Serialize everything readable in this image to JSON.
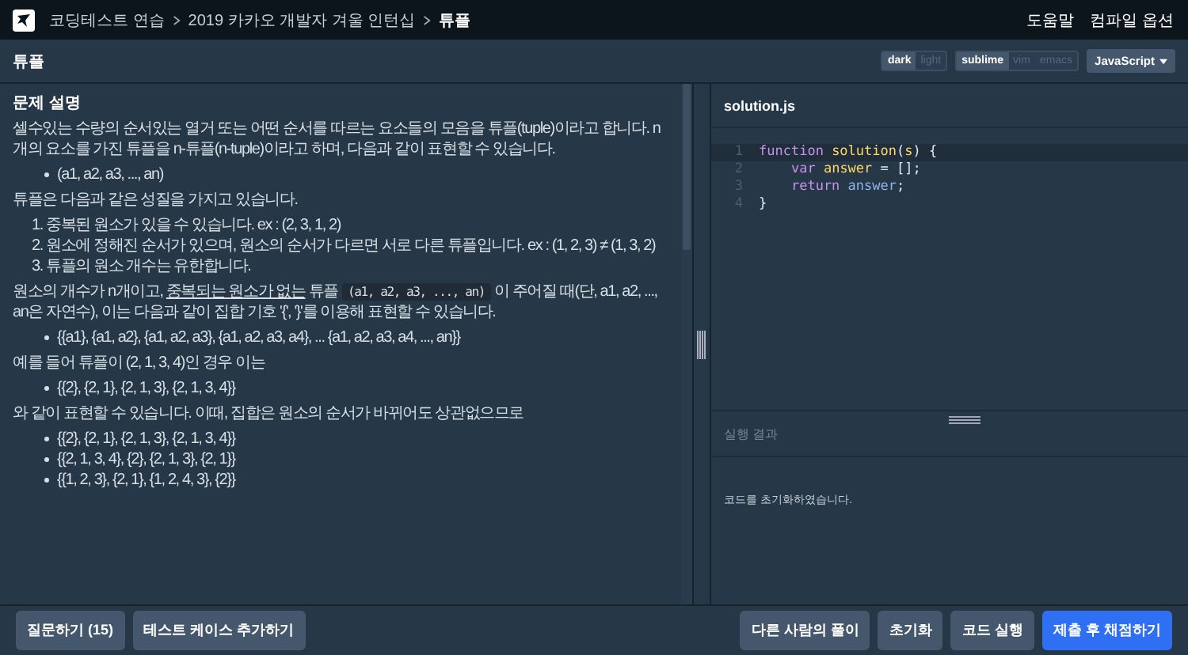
{
  "nav": {
    "breadcrumbs": [
      "코딩테스트 연습",
      "2019 카카오 개발자 겨울 인턴십",
      "튜플"
    ],
    "links": [
      "도움말",
      "컴파일 옵션"
    ]
  },
  "title_bar": {
    "title": "튜플",
    "toggle_groups": [
      [
        {
          "label": "dark",
          "selected": true
        },
        {
          "label": "light",
          "selected": false
        }
      ],
      [
        {
          "label": "sublime",
          "selected": true
        },
        {
          "label": "vim",
          "selected": false
        },
        {
          "label": "emacs",
          "selected": false
        }
      ]
    ],
    "language": "JavaScript"
  },
  "description": [
    {
      "kind": "heading",
      "text": "문제 설명"
    },
    {
      "kind": "paragraph",
      "parts": [
        {
          "kind": "text",
          "text": "셀수있는 수량의 순서있는 열거 또는 어떤 순서를 따르는 요소들의 모음을 튜플(tuple)이라고 합니다. n개의 요소를 가진 튜플을 n-튜플(n-tuple)이라고 하며, 다음과 같이 표현할 수 있습니다."
        }
      ]
    },
    {
      "kind": "bullets",
      "items": [
        "(a1, a2, a3, ..., an)"
      ]
    },
    {
      "kind": "paragraph",
      "parts": [
        {
          "kind": "text",
          "text": "튜플은 다음과 같은 성질을 가지고 있습니다."
        }
      ]
    },
    {
      "kind": "numbered",
      "items": [
        "1. 중복된 원소가 있을 수 있습니다. ex : (2, 3, 1, 2)",
        "2. 원소에 정해진 순서가 있으며, 원소의 순서가 다르면 서로 다른 튜플입니다. ex : (1, 2, 3) ≠ (1, 3, 2)",
        "3. 튜플의 원소 개수는 유한합니다."
      ]
    },
    {
      "kind": "paragraph",
      "parts": [
        {
          "kind": "text",
          "text": "원소의 개수가 n개이고, "
        },
        {
          "kind": "underline",
          "text": "중복되는 원소가 없는"
        },
        {
          "kind": "text",
          "text": " 튜플 "
        },
        {
          "kind": "code",
          "text": "(a1, a2, a3, ..., an)"
        },
        {
          "kind": "text",
          "text": " 이 주어질 때(단, a1, a2, ..., an은 자연수), 이는 다음과 같이 집합 기호 '{', '}'를 이용해 표현할 수 있습니다."
        }
      ]
    },
    {
      "kind": "bullets",
      "items": [
        "{{a1}, {a1, a2}, {a1, a2, a3}, {a1, a2, a3, a4}, ... {a1, a2, a3, a4, ..., an}}"
      ]
    },
    {
      "kind": "paragraph",
      "parts": [
        {
          "kind": "text",
          "text": "예를 들어 튜플이 (2, 1, 3, 4)인 경우 이는"
        }
      ]
    },
    {
      "kind": "bullets",
      "items": [
        "{{2}, {2, 1}, {2, 1, 3}, {2, 1, 3, 4}}"
      ]
    },
    {
      "kind": "paragraph",
      "parts": [
        {
          "kind": "text",
          "text": "와 같이 표현할 수 있습니다. 이때, 집합은 원소의 순서가 바뀌어도 상관없으므로"
        }
      ]
    },
    {
      "kind": "bullets",
      "items": [
        "{{2}, {2, 1}, {2, 1, 3}, {2, 1, 3, 4}}",
        "{{2, 1, 3, 4}, {2}, {2, 1, 3}, {2, 1}}",
        "{{1, 2, 3}, {2, 1}, {1, 2, 4, 3}, {2}}"
      ]
    }
  ],
  "editor": {
    "filename": "solution.js",
    "lines": [
      {
        "number": "1",
        "tokens": [
          {
            "kind": "keyword",
            "text": "function "
          },
          {
            "kind": "name",
            "text": "solution"
          },
          {
            "kind": "plain",
            "text": "("
          },
          {
            "kind": "param",
            "text": "s"
          },
          {
            "kind": "plain",
            "text": ") {"
          }
        ]
      },
      {
        "number": "2",
        "tokens": [
          {
            "kind": "keyword",
            "text": "    var "
          },
          {
            "kind": "name",
            "text": "answer"
          },
          {
            "kind": "plain",
            "text": " = [];"
          }
        ]
      },
      {
        "number": "3",
        "tokens": [
          {
            "kind": "keyword",
            "text": "    return "
          },
          {
            "kind": "variable",
            "text": "answer"
          },
          {
            "kind": "plain",
            "text": ";"
          }
        ]
      },
      {
        "number": "4",
        "tokens": [
          {
            "kind": "plain",
            "text": "}"
          }
        ]
      }
    ]
  },
  "result": {
    "title": "실행 결과",
    "message": "코드를 초기화하였습니다."
  },
  "footer": {
    "left_buttons": [
      {
        "label": "질문하기 (15)",
        "kind": "secondary"
      },
      {
        "label": "테스트 케이스 추가하기",
        "kind": "secondary"
      }
    ],
    "right_buttons": [
      {
        "label": "다른 사람의 풀이",
        "kind": "secondary"
      },
      {
        "label": "초기화",
        "kind": "secondary"
      },
      {
        "label": "코드 실행",
        "kind": "secondary"
      },
      {
        "label": "제출 후 채점하기",
        "kind": "primary"
      }
    ]
  }
}
